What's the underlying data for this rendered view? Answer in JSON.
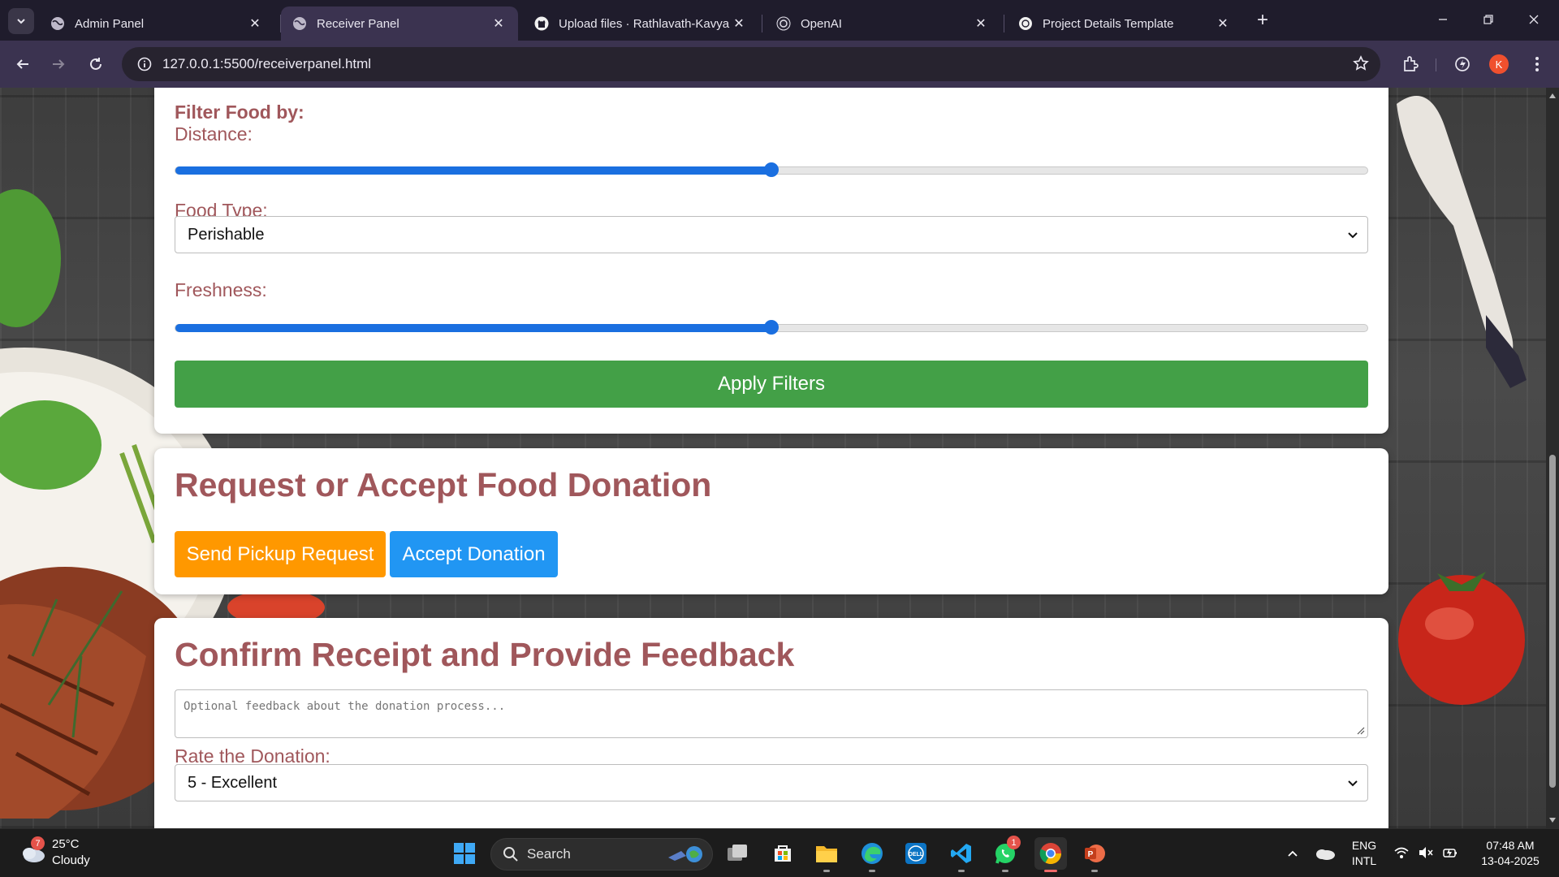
{
  "browser": {
    "tabs": [
      {
        "title": "Admin Panel",
        "icon": "globe-icon",
        "active": false
      },
      {
        "title": "Receiver Panel",
        "icon": "globe-icon",
        "active": true
      },
      {
        "title": "Upload files · Rathlavath-Kavya",
        "icon": "github-icon",
        "active": false
      },
      {
        "title": "OpenAI",
        "icon": "openai-icon",
        "active": false
      },
      {
        "title": "Project Details Template",
        "icon": "openai-icon",
        "active": false
      }
    ],
    "url": "127.0.0.1:5500/receiverpanel.html",
    "profile_initial": "K",
    "accent": "#3b3350"
  },
  "filter": {
    "title": "Filter Food by:",
    "distance_label": "Distance:",
    "distance_value": 0.5,
    "food_type_label": "Food Type:",
    "food_type_selected": "Perishable",
    "freshness_label": "Freshness:",
    "freshness_value": 0.5,
    "apply_label": "Apply Filters"
  },
  "request": {
    "heading": "Request or Accept Food Donation",
    "pickup_label": "Send Pickup Request",
    "accept_label": "Accept Donation"
  },
  "feedback": {
    "heading": "Confirm Receipt and Provide Feedback",
    "placeholder": "Optional feedback about the donation process...",
    "rate_label": "Rate the Donation:",
    "rate_selected": "5 - Excellent"
  },
  "colors": {
    "label": "#a0575b",
    "apply": "#43a047",
    "pickup": "#ff9800",
    "accept": "#2196f3",
    "slider": "#1a6fe0"
  },
  "taskbar": {
    "weather_temp": "25°C",
    "weather_condition": "Cloudy",
    "weather_badge": "7",
    "search_label": "Search",
    "whatsapp_badge": "1",
    "lang_line1": "ENG",
    "lang_line2": "INTL",
    "time": "07:48 AM",
    "date": "13-04-2025"
  }
}
